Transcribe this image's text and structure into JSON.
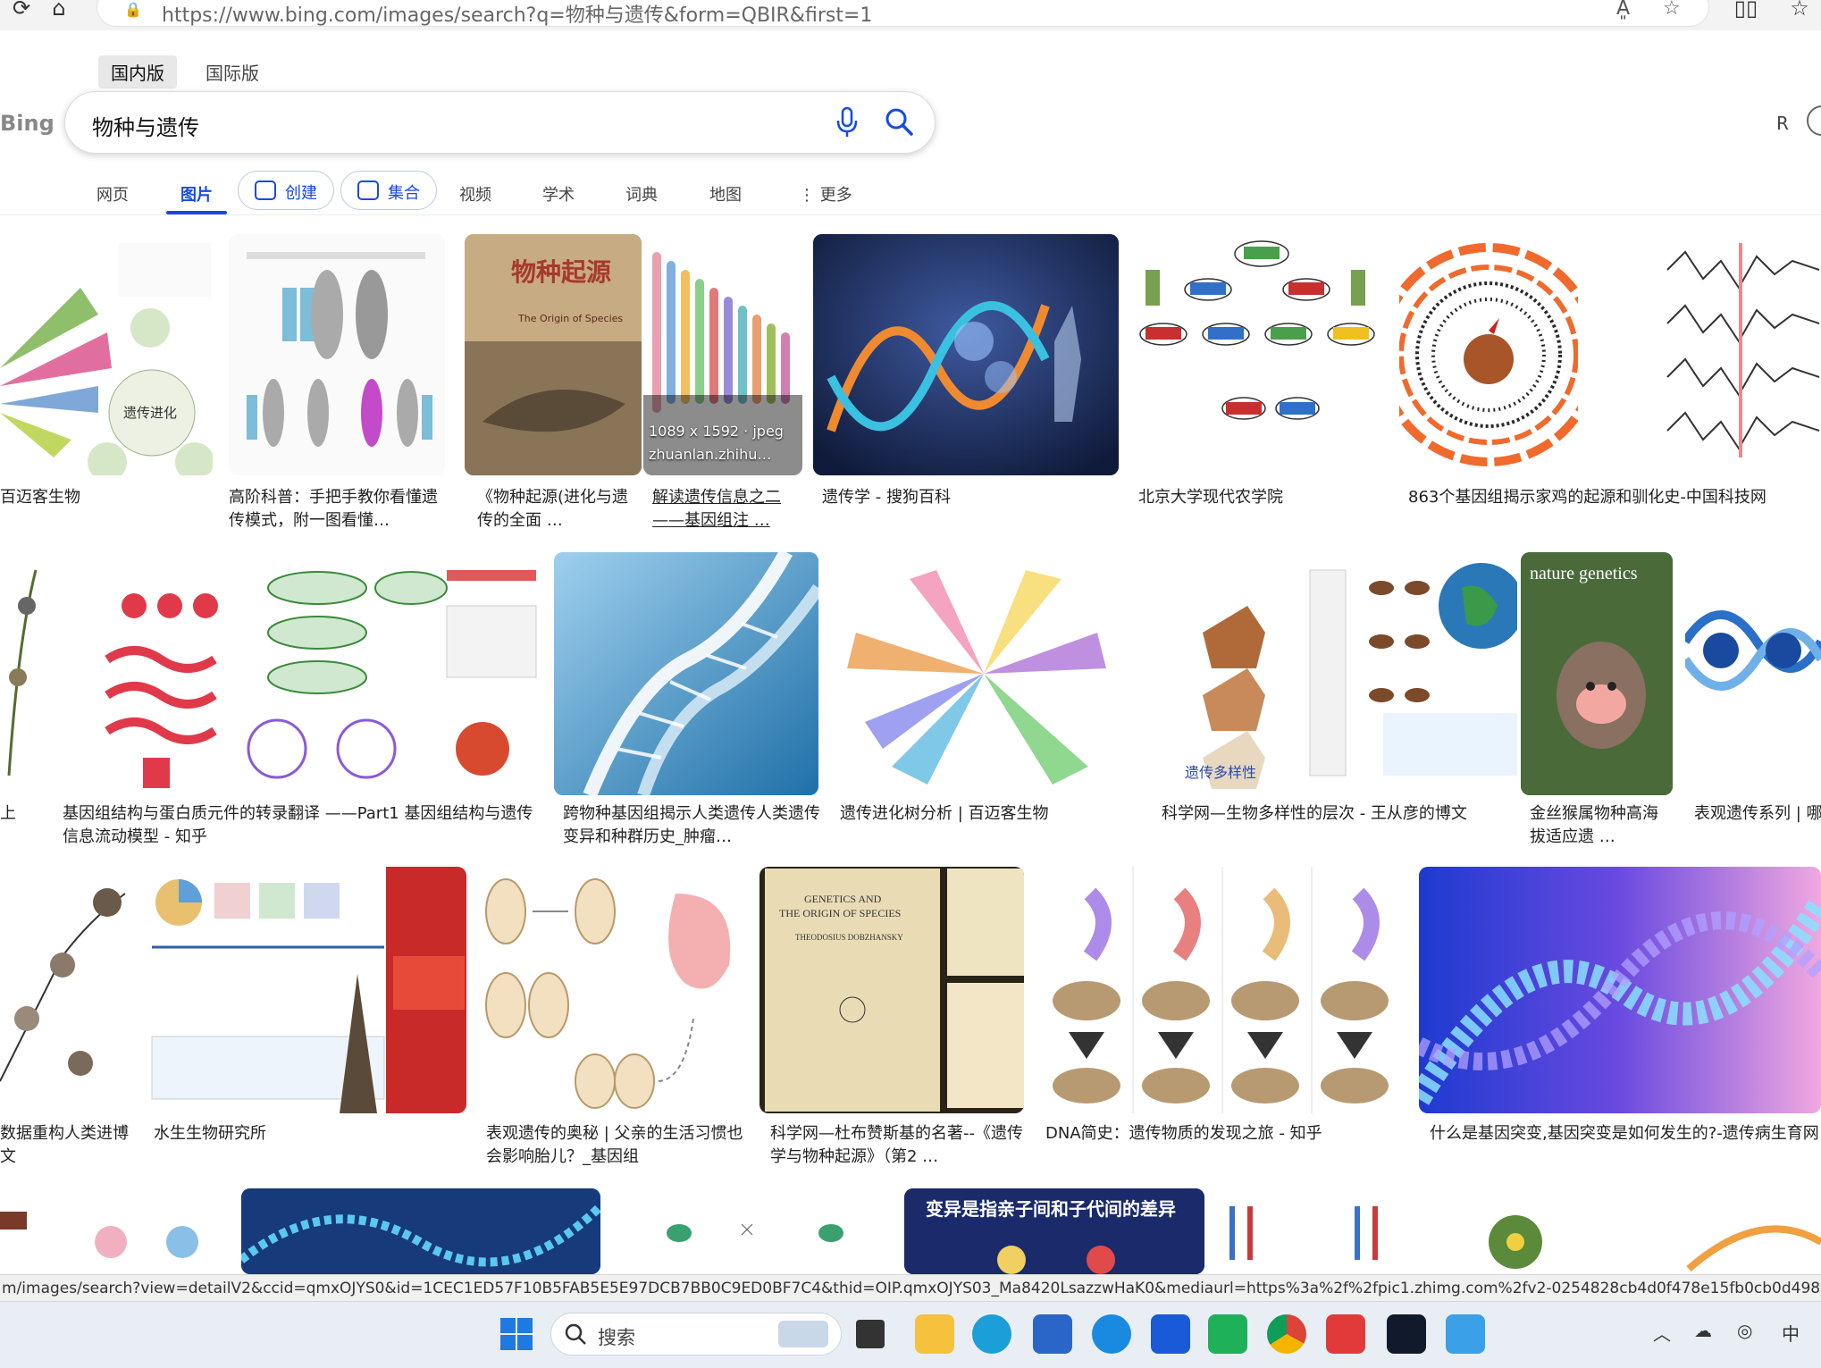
{
  "browser": {
    "url": "https://www.bing.com/images/search?q=物种与遗传&form=QBIR&first=1"
  },
  "bing": {
    "scope_tabs": [
      "国内版",
      "国际版"
    ],
    "logo": "Bing",
    "query": "物种与遗传",
    "profile_initial": "R",
    "nav": {
      "web": "网页",
      "images": "图片",
      "create": "创建",
      "collections": "集合",
      "videos": "视频",
      "academic": "学术",
      "dictionary": "词典",
      "maps": "地图",
      "more": "更多"
    }
  },
  "results": {
    "row1": [
      {
        "caption": "百迈客生物"
      },
      {
        "caption": "高阶科普：手把手教你看懂遗传模式，附一图看懂…"
      },
      {
        "caption": "《物种起源(进化与遗传的全面 …"
      },
      {
        "caption": "解读遗传信息之二——基因组注 …",
        "overlay_size": "1089 x 1592 · jpeg",
        "overlay_source": "zhuanlan.zhihu…"
      },
      {
        "caption": "遗传学 - 搜狗百科"
      },
      {
        "caption": "北京大学现代农学院"
      },
      {
        "caption": "863个基因组揭示家鸡的起源和驯化史-中国科技网"
      },
      {
        "caption": ""
      }
    ],
    "row2": [
      {
        "caption": "上"
      },
      {
        "caption": "基因组结构与蛋白质元件的转录翻译 ——Part1 基因组结构与遗传信息流动模型 - 知乎"
      },
      {
        "caption": "跨物种基因组揭示人类遗传人类遗传变异和种群历史_肿瘤…"
      },
      {
        "caption": "遗传进化树分析 | 百迈客生物"
      },
      {
        "caption": "科学网—生物多样性的层次 - 王从彦的博文"
      },
      {
        "caption": "金丝猴属物种高海拔适应遗 …"
      },
      {
        "caption": "表观遗传系列 | 哪"
      }
    ],
    "row3": [
      {
        "caption": "数据重构人类进博文"
      },
      {
        "caption": "水生生物研究所"
      },
      {
        "caption": "表观遗传的奥秘 | 父亲的生活习惯也会影响胎儿？_基因组"
      },
      {
        "caption": "科学网—杜布赞斯基的名著--《遗传学与物种起源》（第2 …"
      },
      {
        "caption": "DNA简史：遗传物质的发现之旅 - 知乎"
      },
      {
        "caption": "什么是基因突变,基因突变是如何发生的?-遗传病生育网"
      }
    ],
    "image_text": {
      "book_cn": "物种起源",
      "book_en": "The Origin of Species",
      "journal": "nature genetics",
      "book2_line1": "GENETICS AND",
      "book2_line2": "THE ORIGIN OF SPECIES",
      "book2_author": "THEODOSIUS DOBZHANSKY",
      "diversity": "遗传多样性",
      "evo_center": "遗传进化",
      "mutation_label": "变异是指亲子间和子代间的差异"
    }
  },
  "status_url": "m/images/search?view=detailV2&ccid=qmxOJYS0&id=1CEC1ED57F10B5FAB5E5E97DCB7BB0C9ED0BF7C4&thid=OIP.qmxOJYS03_Ma8420LsazzwHaK0&mediaurl=https%3a%2f%2fpic1.zhimg.com%2fv2-0254828cb4d0f478e15fb0cb0d4987e2_r.jpg&exph=15",
  "taskbar": {
    "search_placeholder": "搜索",
    "ime": "中"
  },
  "colors": {
    "accent": "#174ae4",
    "taskbar": "#e9eef5"
  }
}
